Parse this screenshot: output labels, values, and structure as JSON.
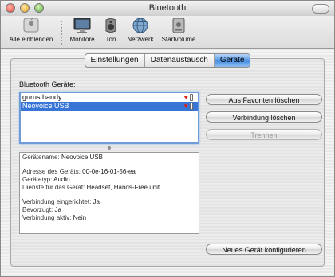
{
  "window": {
    "title": "Bluetooth"
  },
  "toolbar": {
    "items": [
      {
        "label": "Alle einblenden",
        "icon": "show-all-icon"
      },
      {
        "label": "Monitore",
        "icon": "monitor-icon"
      },
      {
        "label": "Ton",
        "icon": "speaker-icon"
      },
      {
        "label": "Netzwerk",
        "icon": "network-globe-icon"
      },
      {
        "label": "Startvolume",
        "icon": "hard-disk-icon"
      }
    ]
  },
  "tabs": [
    {
      "label": "Einstellungen",
      "active": false
    },
    {
      "label": "Datenaustausch",
      "active": false
    },
    {
      "label": "Geräte",
      "active": true
    }
  ],
  "devices": {
    "section_label": "Bluetooth Geräte:",
    "list": [
      {
        "name": "gurus handy",
        "selected": false
      },
      {
        "name": "Neovoice USB",
        "selected": true
      }
    ]
  },
  "details": {
    "lines": [
      {
        "key": "Gerätename:",
        "value": "Neovoice USB"
      },
      {
        "gap": true
      },
      {
        "key": "Adresse des Geräts:",
        "value": "00-0e-16-01-56-ea"
      },
      {
        "key": "Gerätetyp:",
        "value": "Audio"
      },
      {
        "key": "Dienste für das Gerät:",
        "value": "Headset, Hands-Free unit"
      },
      {
        "gap": true
      },
      {
        "key": "Verbindung eingerichtet:",
        "value": "Ja"
      },
      {
        "key": "Bevorzugt:",
        "value": "Ja"
      },
      {
        "key": "Verbindung aktiv:",
        "value": "Nein"
      }
    ]
  },
  "buttons": {
    "remove_favorites": "Aus Favoriten löschen",
    "delete_connection": "Verbindung löschen",
    "disconnect": "Trennen",
    "configure_new": "Neues Gerät konfigurieren"
  },
  "colors": {
    "selection": "#3875d7",
    "focus_ring": "#6f9bd8",
    "heart": "#d9241e"
  }
}
